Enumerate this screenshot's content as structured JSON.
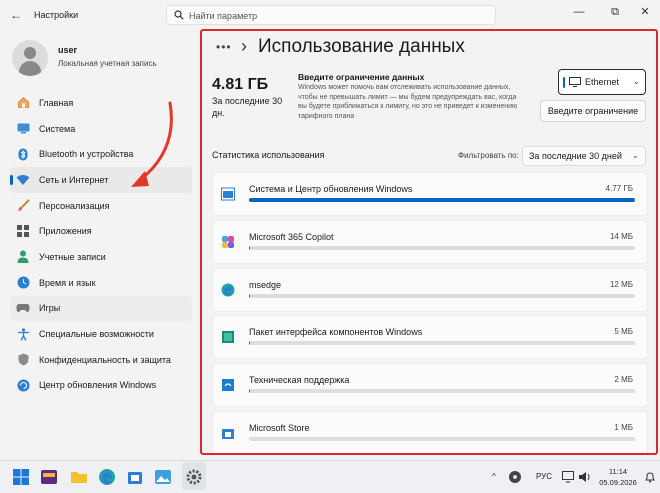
{
  "window": {
    "title": "Настройки",
    "minimize": "—",
    "maximize": "⧉",
    "close": "✕"
  },
  "search": {
    "placeholder": "Найти параметр"
  },
  "user": {
    "name": "user",
    "account_type": "Локальная учетная запись"
  },
  "sidebar": {
    "items": [
      {
        "label": "Главная",
        "icon": "home-icon"
      },
      {
        "label": "Система",
        "icon": "system-icon"
      },
      {
        "label": "Bluetooth и устройства",
        "icon": "bluetooth-icon"
      },
      {
        "label": "Сеть и Интернет",
        "icon": "wifi-icon",
        "active": true
      },
      {
        "label": "Персонализация",
        "icon": "brush-icon"
      },
      {
        "label": "Приложения",
        "icon": "apps-icon"
      },
      {
        "label": "Учетные записи",
        "icon": "account-icon"
      },
      {
        "label": "Время и язык",
        "icon": "globe-clock-icon"
      },
      {
        "label": "Игры",
        "icon": "gamepad-icon"
      },
      {
        "label": "Специальные возможности",
        "icon": "accessibility-icon"
      },
      {
        "label": "Конфиденциальность и защита",
        "icon": "shield-icon"
      },
      {
        "label": "Центр обновления Windows",
        "icon": "update-icon"
      }
    ]
  },
  "main": {
    "breadcrumb_more": "•••",
    "breadcrumb_sep": "›",
    "title": "Использование данных",
    "usage_total": "4.81 ГБ",
    "usage_period": "За последние 30 дн.",
    "limit_title": "Введите ограничение данных",
    "limit_description": "Windows может помочь вам отслеживать использование данных, чтобы не превышать лимит — мы будем предупреждать вас, когда вы будете приближаться к лимиту, но это не приведет к изменению тарифного плана",
    "network_select": "Ethernet",
    "limit_button": "Введите ограничение",
    "stats_title": "Статистика использования",
    "filter_label": "Фильтровать по:",
    "filter_value": "За последние 30 дней",
    "apps": [
      {
        "name": "Система и Центр обновления Windows",
        "size": "4.77 ГБ",
        "fraction": 1.0,
        "icon": "windows-system-icon"
      },
      {
        "name": "Microsoft 365 Copilot",
        "size": "14 МБ",
        "fraction": 0.003,
        "icon": "copilot-icon"
      },
      {
        "name": "msedge",
        "size": "12 МБ",
        "fraction": 0.0025,
        "icon": "edge-icon"
      },
      {
        "name": "Пакет интерфейса компонентов Windows",
        "size": "5 МБ",
        "fraction": 0.001,
        "icon": "package-icon"
      },
      {
        "name": "Техническая поддержка",
        "size": "2 МБ",
        "fraction": 0.0005,
        "icon": "support-icon"
      },
      {
        "name": "Microsoft Store",
        "size": "1 МБ",
        "fraction": 0.0002,
        "icon": "store-icon"
      }
    ]
  },
  "taskbar": {
    "tray_lang": "РУС",
    "time": "11:14",
    "date": "05.09.2026",
    "tray_chevron": "^"
  },
  "colors": {
    "accent": "#0067c0",
    "annotation_red": "#d92b2b"
  }
}
